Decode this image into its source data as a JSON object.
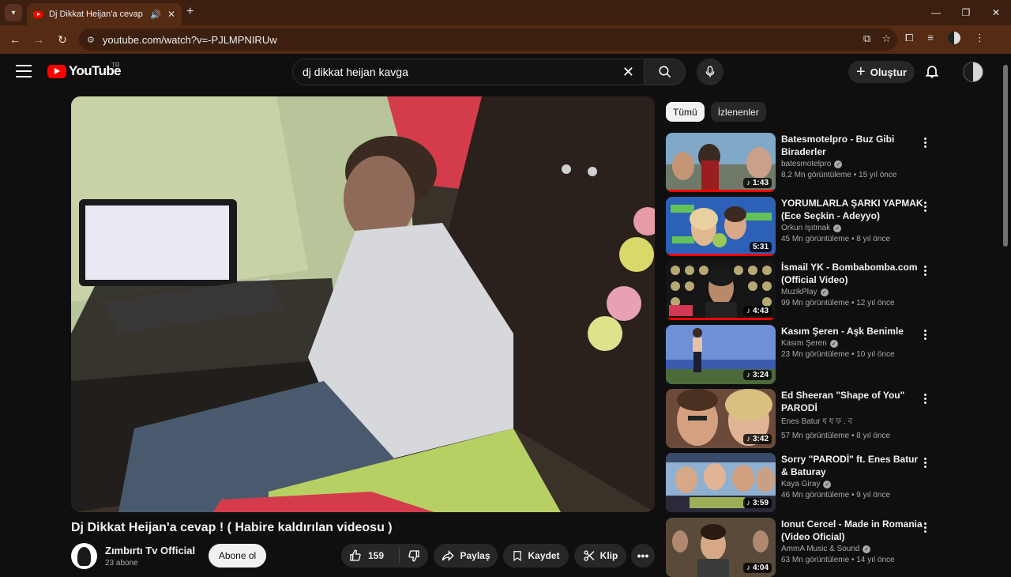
{
  "browser": {
    "tab_title": "Dj Dikkat Heijan'a cevap ! (",
    "url": "youtube.com/watch?v=-PJLMPNIRUw"
  },
  "masthead": {
    "logo_text": "YouTube",
    "country_code": "TR",
    "search_value": "dj dikkat heijan kavga",
    "create_label": "Oluştur"
  },
  "video": {
    "title": "Dj Dikkat Heijan'a cevap ! ( Habire kaldırılan videosu )",
    "channel_name": "Zımbırtı Tv Official",
    "subscribers": "23 abone",
    "subscribe_label": "Abone ol",
    "like_count": "159",
    "share_label": "Paylaş",
    "save_label": "Kaydet",
    "clip_label": "Klip"
  },
  "chips": [
    {
      "label": "Tümü",
      "active": true
    },
    {
      "label": "İzlenenler",
      "active": false
    }
  ],
  "recommendations": [
    {
      "title": "Batesmotelpro - Buz Gibi Biraderler",
      "channel": "batesmotelpro",
      "verified": true,
      "views": "8,2 Mn görüntüleme",
      "age": "15 yıl önce",
      "duration": "1:43",
      "watched": true
    },
    {
      "title": "YORUMLARLA ŞARKI YAPMAK (Ece Seçkin - Adeyyo)",
      "channel": "Orkun Işıtmak",
      "verified": true,
      "views": "45 Mn görüntüleme",
      "age": "8 yıl önce",
      "duration": "5:31",
      "watched": true
    },
    {
      "title": "İsmail YK - Bombabomba.com (Official Video)",
      "channel": "MuzikPlay",
      "verified": true,
      "views": "99 Mn görüntüleme",
      "age": "12 yıl önce",
      "duration": "4:43",
      "watched": true
    },
    {
      "title": "Kasım Şeren - Aşk Benimle",
      "channel": "Kasım Şeren",
      "verified": true,
      "views": "23 Mn görüntüleme",
      "age": "10 yıl önce",
      "duration": "3:24",
      "watched": false
    },
    {
      "title": "Ed Sheeran \"Shape of You\" PARODİ",
      "channel": "Enes Batur ধ ধ ফ . ব",
      "verified": false,
      "views": "57 Mn görüntüleme",
      "age": "8 yıl önce",
      "duration": "3:42",
      "watched": false
    },
    {
      "title": "Sorry \"PARODİ\" ft. Enes Batur & Baturay",
      "channel": "Kaya Giray",
      "verified": true,
      "views": "46 Mn görüntüleme",
      "age": "9 yıl önce",
      "duration": "3:59",
      "watched": false
    },
    {
      "title": "Ionut Cercel - Made in Romania (Video Oficial)",
      "channel": "AmmA Music & Sound",
      "verified": true,
      "views": "63 Mn görüntüleme",
      "age": "14 yıl önce",
      "duration": "4:04",
      "watched": false
    }
  ],
  "colors": {
    "background": "#0f0f0f",
    "brand_red": "#ff0000",
    "tab_bar": "#3c1f0e",
    "toolbar": "#552b14"
  }
}
